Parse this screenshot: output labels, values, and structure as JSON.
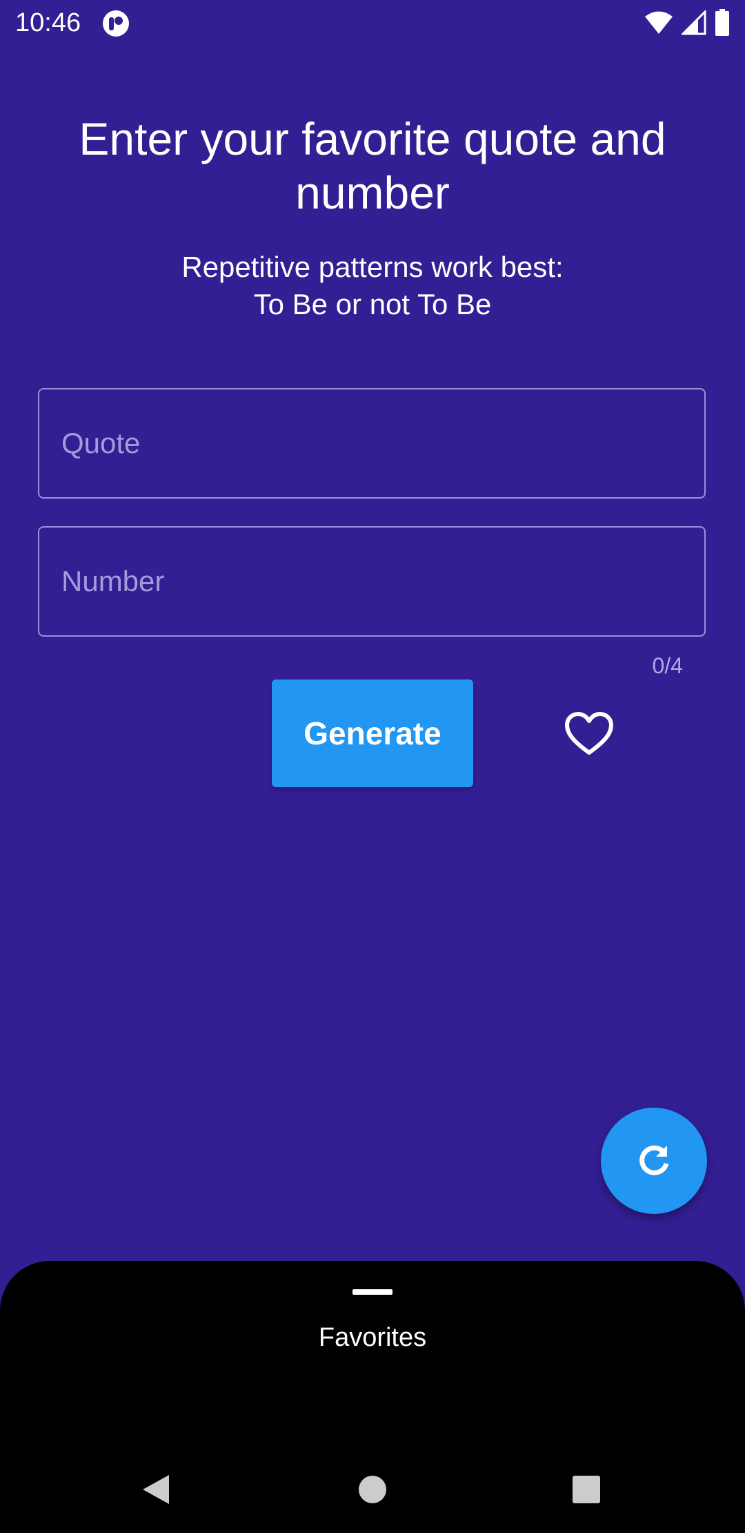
{
  "status_bar": {
    "time": "10:46",
    "icons": [
      "app-notification-icon",
      "wifi-icon",
      "signal-icon",
      "battery-icon"
    ]
  },
  "header": {
    "title": "Enter your favorite quote and number",
    "subtitle_line1": "Repetitive patterns work best:",
    "subtitle_line2": "To Be or not To Be"
  },
  "form": {
    "quote": {
      "value": "",
      "placeholder": "Quote"
    },
    "number": {
      "value": "",
      "placeholder": "Number",
      "counter": "0/4"
    },
    "generate_label": "Generate",
    "favorite_icon": "heart-outline-icon"
  },
  "fab": {
    "icon": "refresh-icon"
  },
  "bottom_sheet": {
    "title": "Favorites"
  },
  "nav_bar": {
    "buttons": [
      "back-icon",
      "home-icon",
      "recents-icon"
    ]
  },
  "colors": {
    "background": "#331e93",
    "accent": "#2296f3",
    "sheet": "#000000",
    "field_border": "#9c8fd9",
    "placeholder": "#a49adc",
    "nav_icon": "#cccccc"
  }
}
